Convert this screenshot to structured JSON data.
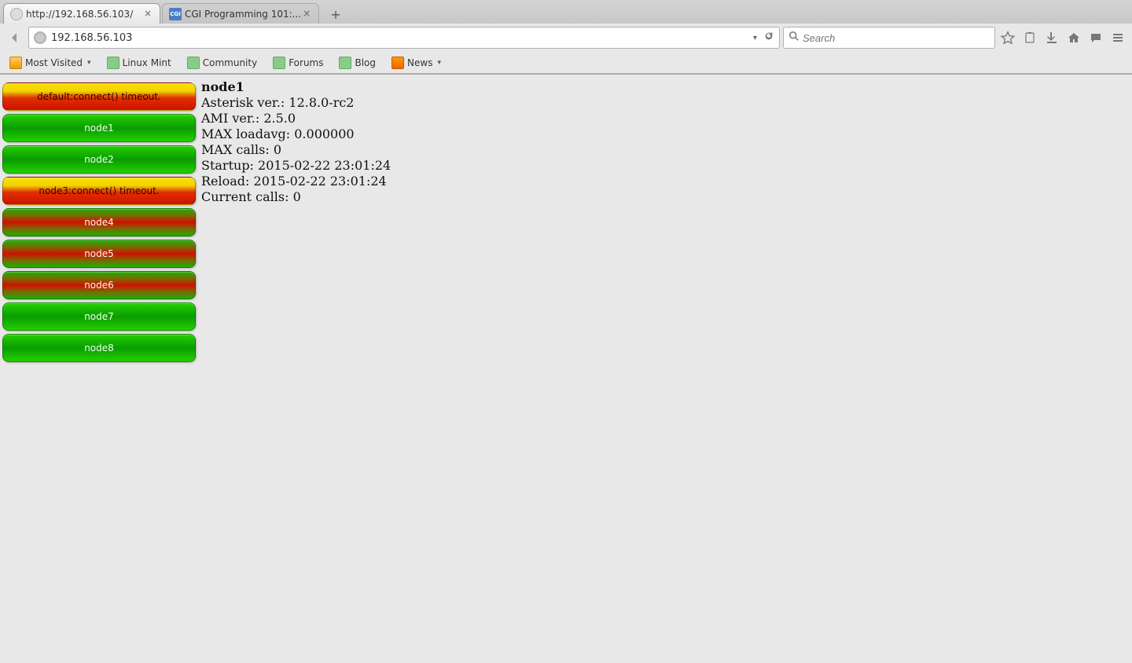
{
  "tabs": [
    {
      "title": "http://192.168.56.103/",
      "favicon": "globe",
      "active": true
    },
    {
      "title": "CGI Programming 101:...",
      "favicon": "cgi",
      "active": false
    }
  ],
  "url": "192.168.56.103",
  "search_placeholder": "Search",
  "bookmarks": [
    {
      "label": "Most Visited",
      "icon": "folder",
      "dropdown": true
    },
    {
      "label": "Linux Mint",
      "icon": "mint",
      "dropdown": false
    },
    {
      "label": "Community",
      "icon": "mint",
      "dropdown": false
    },
    {
      "label": "Forums",
      "icon": "mint",
      "dropdown": false
    },
    {
      "label": "Blog",
      "icon": "mint",
      "dropdown": false
    },
    {
      "label": "News",
      "icon": "rss",
      "dropdown": true
    }
  ],
  "nodes": [
    {
      "label": "default:connect() timeout.",
      "status": "error"
    },
    {
      "label": "node1",
      "status": "ok"
    },
    {
      "label": "node2",
      "status": "ok"
    },
    {
      "label": "node3:connect() timeout.",
      "status": "error"
    },
    {
      "label": "node4",
      "status": "warn"
    },
    {
      "label": "node5",
      "status": "warn"
    },
    {
      "label": "node6",
      "status": "warn"
    },
    {
      "label": "node7",
      "status": "ok"
    },
    {
      "label": "node8",
      "status": "ok"
    }
  ],
  "details": {
    "title": "node1",
    "asterisk_ver_label": "Asterisk ver.: ",
    "asterisk_ver": "12.8.0-rc2",
    "ami_ver_label": "AMI ver.: ",
    "ami_ver": "2.5.0",
    "max_loadavg_label": "MAX loadavg: ",
    "max_loadavg": "0.000000",
    "max_calls_label": "MAX calls: ",
    "max_calls": "0",
    "startup_label": "Startup: ",
    "startup": "2015-02-22 23:01:24",
    "reload_label": "Reload: ",
    "reload": "2015-02-22 23:01:24",
    "current_calls_label": "Current calls: ",
    "current_calls": "0"
  }
}
